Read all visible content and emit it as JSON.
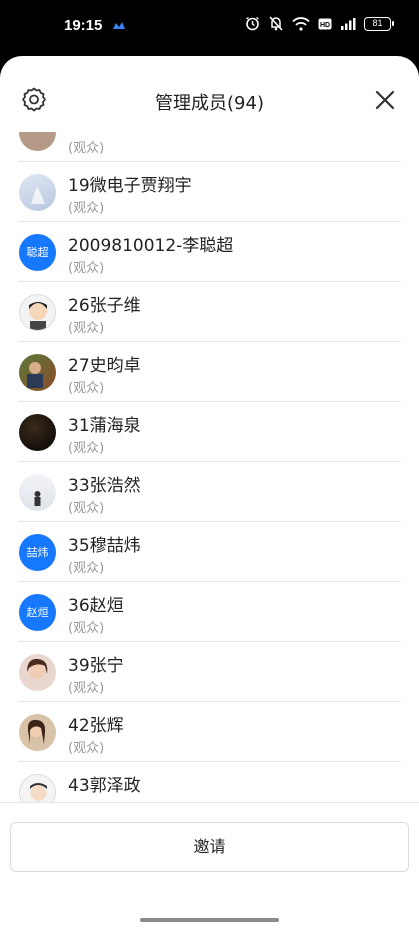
{
  "status_bar": {
    "time": "19:15",
    "battery": "81"
  },
  "header": {
    "title": "管理成员(94)"
  },
  "members": [
    {
      "name": "",
      "role": "(观众)",
      "avatar": "photo"
    },
    {
      "name": "19微电子贾翔宇",
      "role": "(观众)",
      "avatar": "photo"
    },
    {
      "name": "2009810012-李聪超",
      "role": "(观众)",
      "avatar": "text",
      "avatar_text": "聪超"
    },
    {
      "name": "26张子维",
      "role": "(观众)",
      "avatar": "photo"
    },
    {
      "name": "27史昀卓",
      "role": "(观众)",
      "avatar": "photo"
    },
    {
      "name": "31蒲海泉",
      "role": "(观众)",
      "avatar": "photo"
    },
    {
      "name": "33张浩然",
      "role": "(观众)",
      "avatar": "photo"
    },
    {
      "name": "35穆喆炜",
      "role": "(观众)",
      "avatar": "text",
      "avatar_text": "喆炜"
    },
    {
      "name": "36赵烜",
      "role": "(观众)",
      "avatar": "text",
      "avatar_text": "赵烜"
    },
    {
      "name": "39张宁",
      "role": "(观众)",
      "avatar": "photo"
    },
    {
      "name": "42张辉",
      "role": "(观众)",
      "avatar": "photo"
    },
    {
      "name": "43郭泽政",
      "role": "",
      "avatar": "photo"
    }
  ],
  "invite_label": "邀请",
  "colors": {
    "accent": "#1677ff",
    "muted_text": "#999999"
  }
}
